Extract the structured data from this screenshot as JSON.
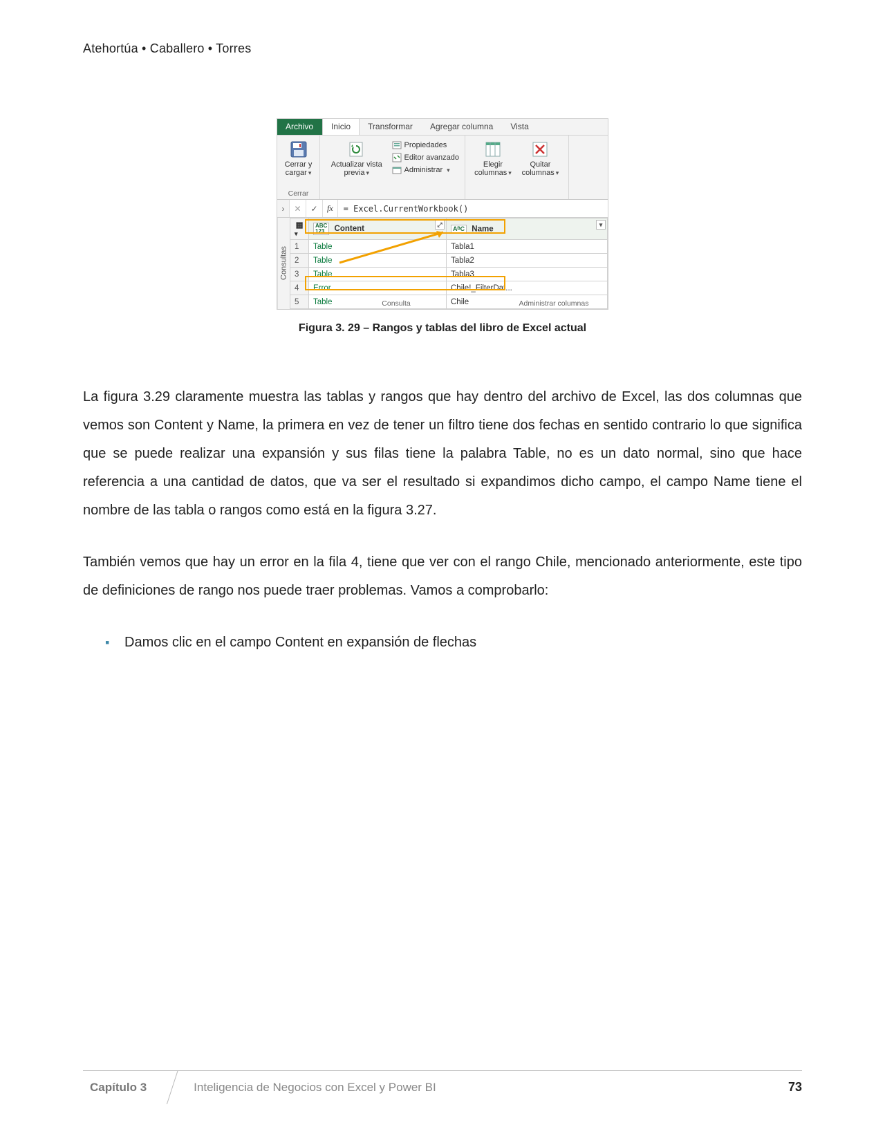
{
  "running_head": "Atehortúa • Caballero • Torres",
  "ribbon": {
    "tabs": {
      "file": "Archivo",
      "home": "Inicio",
      "transform": "Transformar",
      "addcol": "Agregar columna",
      "view": "Vista"
    },
    "close_load": "Cerrar y cargar",
    "refresh": "Actualizar vista previa",
    "props": "Propiedades",
    "adv_editor": "Editor avanzado",
    "manage": "Administrar",
    "choose_cols": "Elegir columnas",
    "remove_cols": "Quitar columnas",
    "group_close": "Cerrar",
    "group_query": "Consulta",
    "group_cols": "Administrar columnas"
  },
  "formula": {
    "fx": "fx",
    "text": "= Excel.CurrentWorkbook()"
  },
  "side_tab": "Consultas",
  "columns": {
    "content": "Content",
    "name": "Name",
    "content_type": "ABC\n123",
    "name_type": "AᴮC"
  },
  "rows": [
    {
      "n": "1",
      "content": "Table",
      "name": "Tabla1"
    },
    {
      "n": "2",
      "content": "Table",
      "name": "Tabla2"
    },
    {
      "n": "3",
      "content": "Table",
      "name": "Tabla3"
    },
    {
      "n": "4",
      "content": "Error",
      "name": "Chile!_FilterDat..."
    },
    {
      "n": "5",
      "content": "Table",
      "name": "Chile"
    }
  ],
  "caption": "Figura 3. 29 – Rangos y tablas del libro de Excel actual",
  "para1": "La figura 3.29 claramente muestra las tablas y rangos que hay dentro del archivo de Excel, las dos columnas que vemos son Content y Name, la primera en vez de tener un filtro tiene dos fechas en sentido contrario lo que significa que se puede realizar una expansión y sus filas tiene la palabra Table, no es un dato normal, sino que hace referencia a una cantidad de datos, que va ser el resultado si expandimos dicho campo, el campo Name tiene el nombre de las tabla o rangos como está en la figura 3.27.",
  "para2": "También vemos que hay un error en la fila 4, tiene que ver con el rango Chile, mencionado anteriormente, este tipo de definiciones de rango nos puede traer problemas. Vamos a comprobarlo:",
  "bullet1": "Damos clic en el campo Content en expansión de flechas",
  "footer": {
    "chapter": "Capítulo 3",
    "title": "Inteligencia de Negocios con Excel y Power BI",
    "page": "73"
  }
}
